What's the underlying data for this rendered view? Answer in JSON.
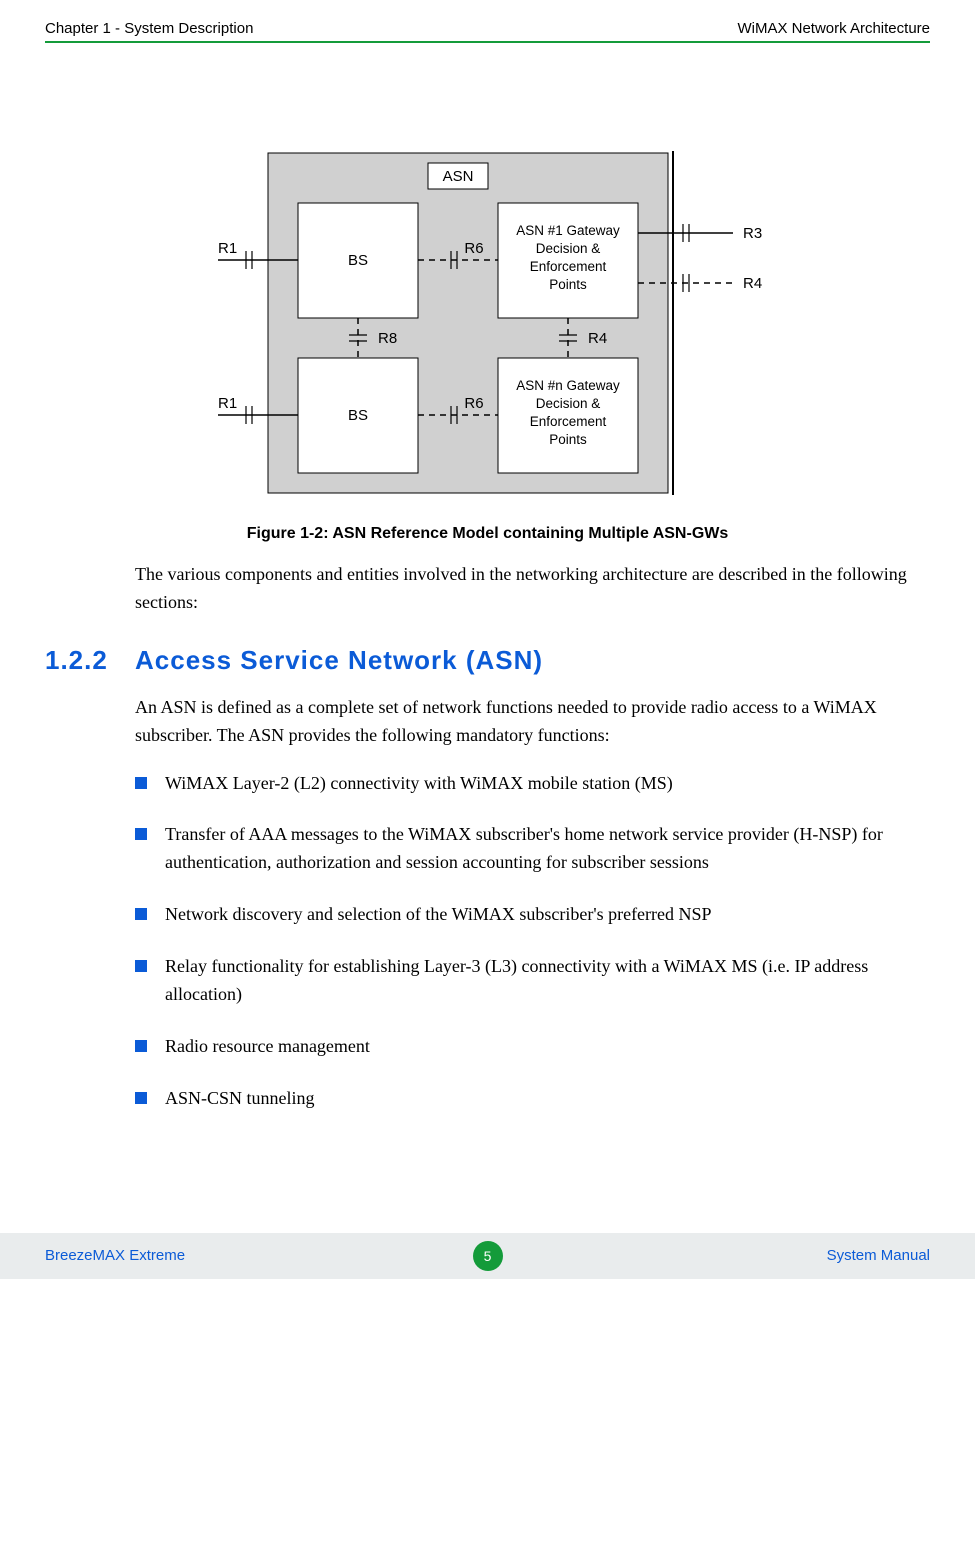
{
  "header": {
    "left": "Chapter 1 - System Description",
    "right": "WiMAX Network Architecture"
  },
  "figure": {
    "caption": "Figure 1-2: ASN Reference Model containing Multiple ASN-GWs",
    "labels": {
      "asn": "ASN",
      "bs1": "BS",
      "bs2": "BS",
      "gw1_l1": "ASN #1 Gateway",
      "gw1_l2": "Decision &",
      "gw1_l3": "Enforcement",
      "gw1_l4": "Points",
      "gw2_l1": "ASN #n Gateway",
      "gw2_l2": "Decision &",
      "gw2_l3": "Enforcement",
      "gw2_l4": "Points",
      "r1a": "R1",
      "r1b": "R1",
      "r6a": "R6",
      "r6b": "R6",
      "r8": "R8",
      "r4m": "R4",
      "r3": "R3",
      "r4r": "R4"
    }
  },
  "intro_text": "The various components and entities involved in the networking architecture are described in the following sections:",
  "section": {
    "number": "1.2.2",
    "title": "Access Service Network (ASN)"
  },
  "section_intro": "An ASN is defined as a complete set of network functions needed to provide radio access to a WiMAX subscriber. The ASN provides the following mandatory functions:",
  "bullets": [
    "WiMAX Layer-2 (L2) connectivity with WiMAX mobile station (MS)",
    "Transfer of AAA messages to the WiMAX subscriber's home network service provider (H-NSP) for authentication, authorization and session accounting for subscriber sessions",
    "Network discovery and selection of the WiMAX subscriber's preferred NSP",
    "Relay functionality for establishing Layer-3 (L3) connectivity with a WiMAX MS (i.e. IP address allocation)",
    "Radio resource management",
    "ASN-CSN tunneling"
  ],
  "footer": {
    "left": "BreezeMAX Extreme",
    "page": "5",
    "right": "System Manual"
  }
}
